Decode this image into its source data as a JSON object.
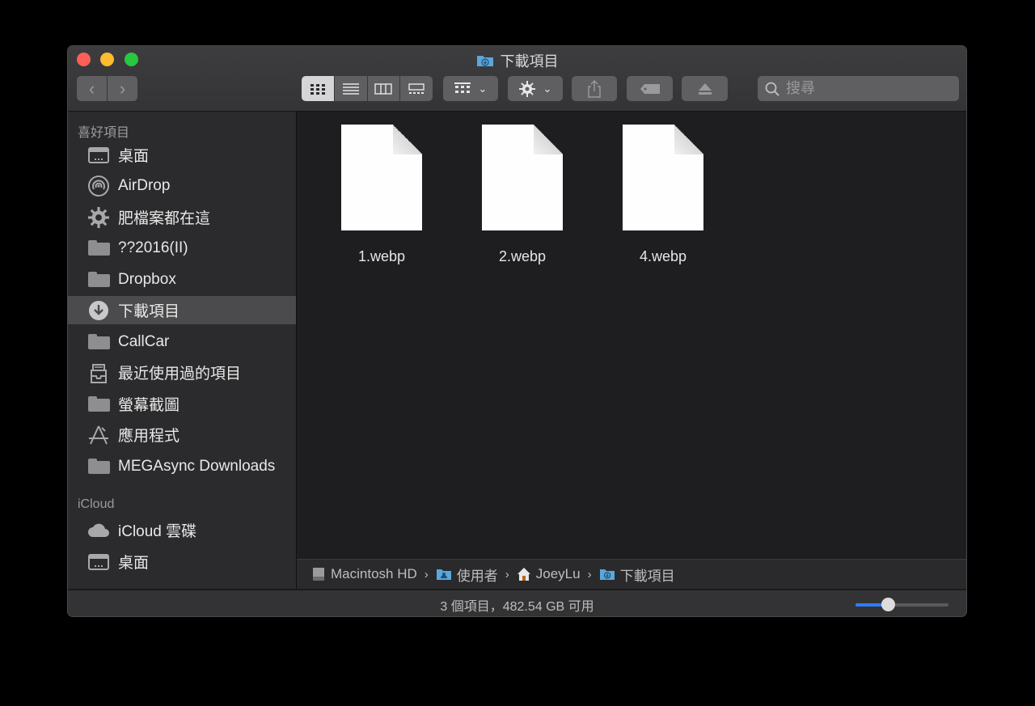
{
  "window": {
    "title": "下載項目"
  },
  "toolbar": {
    "back_label": "‹",
    "forward_label": "›",
    "search_placeholder": "搜尋"
  },
  "sidebar": {
    "favorites_header": "喜好項目",
    "favorites": [
      {
        "label": "桌面",
        "icon": "desktop-icon"
      },
      {
        "label": "AirDrop",
        "icon": "airdrop-icon"
      },
      {
        "label": "肥檔案都在這",
        "icon": "gear-icon"
      },
      {
        "label": "??2016(II)",
        "icon": "folder-icon"
      },
      {
        "label": "Dropbox",
        "icon": "folder-icon"
      },
      {
        "label": "下載項目",
        "icon": "download-icon",
        "selected": true
      },
      {
        "label": "CallCar",
        "icon": "folder-icon"
      },
      {
        "label": "最近使用過的項目",
        "icon": "recents-icon"
      },
      {
        "label": "螢幕截圖",
        "icon": "folder-icon"
      },
      {
        "label": "應用程式",
        "icon": "applications-icon"
      },
      {
        "label": "MEGAsync Downloads",
        "icon": "folder-icon"
      }
    ],
    "icloud_header": "iCloud",
    "icloud": [
      {
        "label": "iCloud 雲碟",
        "icon": "cloud-icon"
      },
      {
        "label": "桌面",
        "icon": "desktop-icon"
      }
    ]
  },
  "files": [
    {
      "name": "1.webp"
    },
    {
      "name": "2.webp"
    },
    {
      "name": "4.webp"
    }
  ],
  "path": [
    {
      "label": "Macintosh HD",
      "icon": "hard-drive-icon"
    },
    {
      "label": "使用者",
      "icon": "users-folder-icon"
    },
    {
      "label": "JoeyLu",
      "icon": "home-icon"
    },
    {
      "label": "下載項目",
      "icon": "downloads-folder-icon"
    }
  ],
  "status": {
    "text": "3 個項目，482.54 GB 可用"
  },
  "icon_size_fraction": 0.35,
  "colors": {
    "accent": "#2f7df6",
    "close": "#fe5f57",
    "minimize": "#febc2e",
    "maximize": "#28c840",
    "folder_blue": "#5aa7dc"
  }
}
